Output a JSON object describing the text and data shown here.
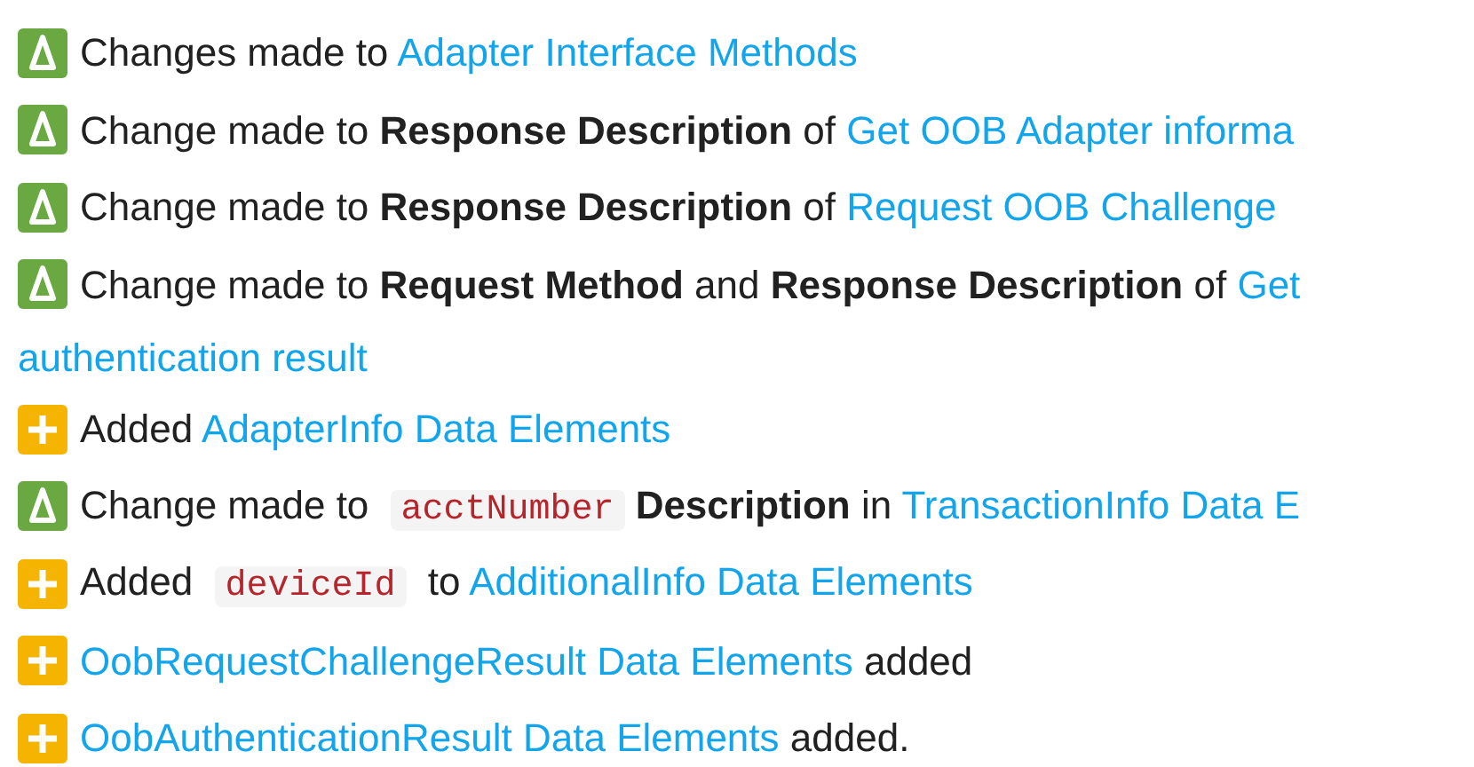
{
  "changes": [
    {
      "kind": "changed",
      "parts": [
        {
          "kind": "text",
          "text": "Changes made to "
        },
        {
          "kind": "link",
          "text": "Adapter Interface Methods"
        }
      ]
    },
    {
      "kind": "changed",
      "parts": [
        {
          "kind": "text",
          "text": "Change made to "
        },
        {
          "kind": "bold",
          "text": "Response Description"
        },
        {
          "kind": "text",
          "text": " of "
        },
        {
          "kind": "link",
          "text": "Get OOB Adapter informa"
        }
      ]
    },
    {
      "kind": "changed",
      "parts": [
        {
          "kind": "text",
          "text": "Change made to "
        },
        {
          "kind": "bold",
          "text": "Response Description"
        },
        {
          "kind": "text",
          "text": " of "
        },
        {
          "kind": "link",
          "text": "Request OOB Challenge"
        }
      ]
    },
    {
      "kind": "changed",
      "parts": [
        {
          "kind": "text",
          "text": "Change made to "
        },
        {
          "kind": "bold",
          "text": "Request Method"
        },
        {
          "kind": "text",
          "text": " and "
        },
        {
          "kind": "bold",
          "text": "Response Description"
        },
        {
          "kind": "text",
          "text": " of "
        },
        {
          "kind": "link",
          "text": "Get"
        }
      ],
      "continuation": "authentication result"
    },
    {
      "kind": "added",
      "parts": [
        {
          "kind": "text",
          "text": "Added "
        },
        {
          "kind": "link",
          "text": "AdapterInfo Data Elements"
        }
      ]
    },
    {
      "kind": "changed",
      "parts": [
        {
          "kind": "text",
          "text": "Change made to "
        },
        {
          "kind": "code",
          "text": "acctNumber"
        },
        {
          "kind": "bold",
          "text": "Description"
        },
        {
          "kind": "text",
          "text": " in "
        },
        {
          "kind": "link",
          "text": "TransactionInfo Data E"
        }
      ]
    },
    {
      "kind": "added",
      "parts": [
        {
          "kind": "text",
          "text": "Added "
        },
        {
          "kind": "code",
          "text": "deviceId"
        },
        {
          "kind": "text",
          "text": " to "
        },
        {
          "kind": "link",
          "text": "AdditionalInfo Data Elements"
        }
      ]
    },
    {
      "kind": "added",
      "parts": [
        {
          "kind": "link",
          "text": "OobRequestChallengeResult Data Elements"
        },
        {
          "kind": "text",
          "text": " added"
        }
      ]
    },
    {
      "kind": "added",
      "parts": [
        {
          "kind": "link",
          "text": "OobAuthenticationResult Data Elements"
        },
        {
          "kind": "text",
          "text": " added."
        }
      ]
    }
  ]
}
